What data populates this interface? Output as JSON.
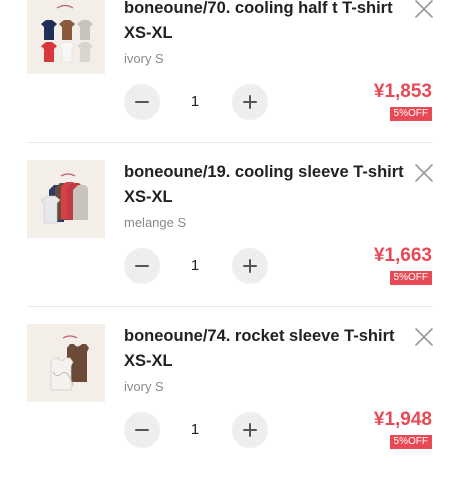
{
  "cart": {
    "items": [
      {
        "title": "boneoune/70. cooling half t T-shirt XS-XL",
        "variant": "ivory S",
        "quantity": "1",
        "price": "¥1,853",
        "discount": "5%OFF",
        "thumb_icon": "tshirt-grid-product-photo"
      },
      {
        "title": "boneoune/19. cooling sleeve T-shirt XS-XL",
        "variant": "melange S",
        "quantity": "1",
        "price": "¥1,663",
        "discount": "5%OFF",
        "thumb_icon": "tshirt-fan-product-photo"
      },
      {
        "title": "boneoune/74. rocket sleeve T-shirt XS-XL",
        "variant": "ivory S",
        "quantity": "1",
        "price": "¥1,948",
        "discount": "5%OFF",
        "thumb_icon": "tanktop-product-photo"
      }
    ]
  },
  "icons": {
    "remove": "close-icon",
    "decrement": "minus-icon",
    "increment": "plus-icon"
  },
  "colors": {
    "price": "#e84a55",
    "badge_bg": "#e84a55",
    "badge_text": "#ffffff",
    "title": "#222222",
    "variant": "#8a8a8a",
    "qty_button_bg": "#eeeeee",
    "divider": "#e8e8e8"
  }
}
